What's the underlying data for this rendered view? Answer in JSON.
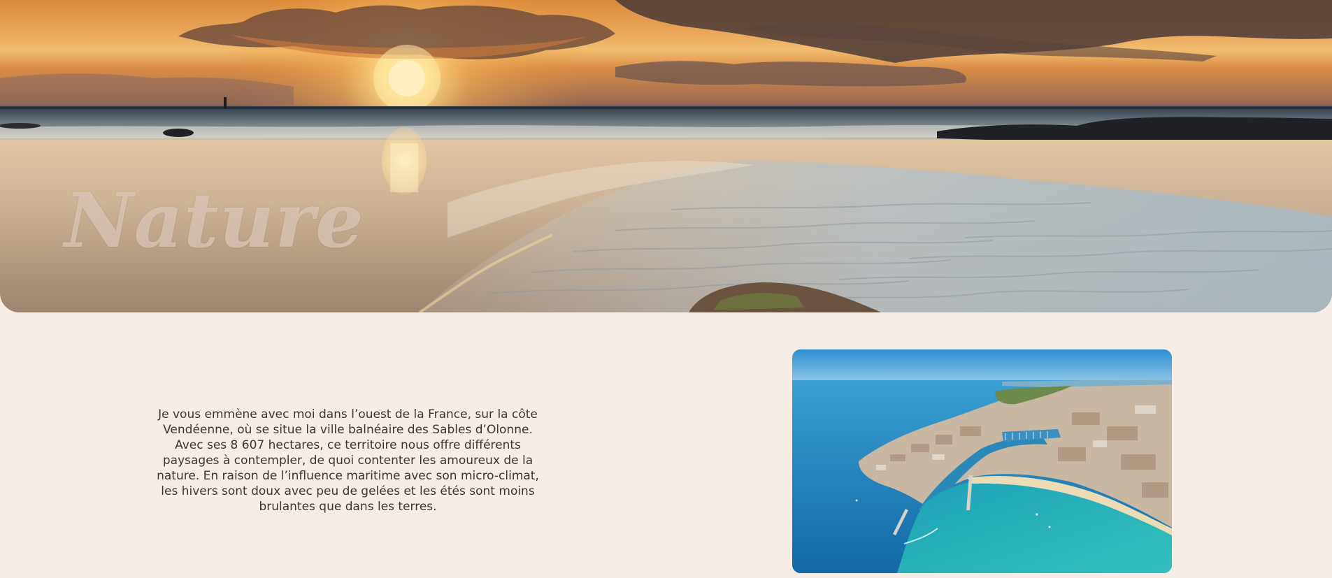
{
  "hero": {
    "title": "Nature",
    "image": "beach-sunset-photo",
    "colors": {
      "sky": "#e9a55a",
      "sun": "#fff3c4",
      "sand": "#c8ae92",
      "sea": "#9fb3bd"
    }
  },
  "intro": {
    "text": "Je vous emmène avec moi dans l’ouest de la France, sur la côte Vendéenne, où se situe la ville balnéaire des Sables d’Olonne. Avec ses 8 607 hectares, ce territoire nous offre différents paysages à contempler, de quoi contenter les amoureux de la nature. En raison de l’influence maritime avec son micro-climat, les hivers sont doux avec peu de gelées et les étés sont moins brulantes que dans les terres."
  },
  "aerial_photo": {
    "image": "aerial-coast-photo",
    "colors": {
      "sea": "#1a8ac4",
      "lagoon": "#2ab0b8",
      "beach": "#e8d9b5",
      "town": "#c9b8a4"
    }
  },
  "page": {
    "background": "#f6ede6",
    "text_color": "#3b3632"
  }
}
